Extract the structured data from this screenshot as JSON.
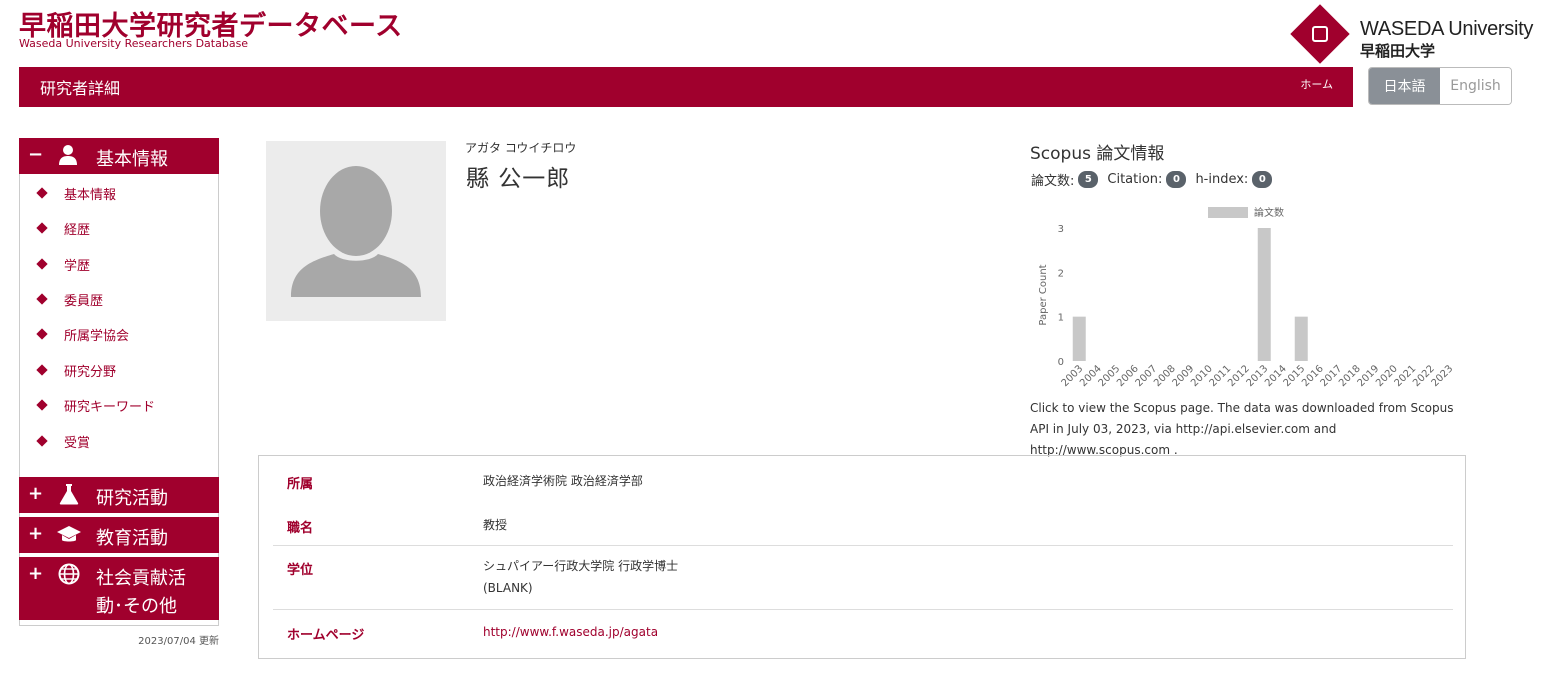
{
  "header": {
    "site_title": "早稲田大学研究者データベース",
    "site_subtitle": "Waseda University Researchers Database",
    "logo_en": "WASEDA University",
    "logo_jp": "早稲田大学"
  },
  "navbar": {
    "title": "研究者詳細",
    "home": "ホーム"
  },
  "lang": {
    "ja": "日本語",
    "en": "English"
  },
  "sidebar": {
    "sections": [
      {
        "sign": "−",
        "label": "基本情報",
        "icon": "person-icon"
      },
      {
        "sign": "+",
        "label": "研究活動",
        "icon": "flask-icon"
      },
      {
        "sign": "+",
        "label": "教育活動",
        "icon": "graduation-cap-icon"
      },
      {
        "sign": "+",
        "label": "社会貢献活動･その他",
        "label_line1": "社会貢献活",
        "label_line2": "動･その他",
        "icon": "globe-icon"
      }
    ],
    "items": [
      "基本情報",
      "経歴",
      "学歴",
      "委員歴",
      "所属学協会",
      "研究分野",
      "研究キーワード",
      "受賞"
    ],
    "updated": "2023/07/04 更新"
  },
  "profile": {
    "kana": "アガタ コウイチロウ",
    "name": "縣 公一郎"
  },
  "scopus": {
    "title": "Scopus 論文情報",
    "papers_label": "論文数:",
    "papers": "5",
    "citation_label": "Citation:",
    "citation": "0",
    "hindex_label": "h-index:",
    "hindex": "0",
    "note": "Click to view the Scopus page. The data was downloaded from Scopus API in July 03, 2023, via http://api.elsevier.com and http://www.scopus.com ."
  },
  "chart_data": {
    "type": "bar",
    "categories": [
      "2003",
      "2004",
      "2005",
      "2006",
      "2007",
      "2008",
      "2009",
      "2010",
      "2011",
      "2012",
      "2013",
      "2014",
      "2015",
      "2016",
      "2017",
      "2018",
      "2019",
      "2020",
      "2021",
      "2022",
      "2023"
    ],
    "series": [
      {
        "name": "論文数",
        "values": [
          1,
          0,
          0,
          0,
          0,
          0,
          0,
          0,
          0,
          0,
          3,
          0,
          1,
          0,
          0,
          0,
          0,
          0,
          0,
          0,
          0
        ]
      }
    ],
    "xlabel": "",
    "ylabel": "Paper Count",
    "ylim": [
      0,
      3
    ],
    "yticks": [
      "0",
      "1",
      "2",
      "3"
    ],
    "legend_position": "top",
    "grid": false,
    "bar_color": "#c8c8c8"
  },
  "info": {
    "rows": [
      {
        "label": "所属",
        "value": "政治経済学術院 政治経済学部"
      },
      {
        "label": "職名",
        "value": "教授"
      },
      {
        "label": "学位",
        "value_line1": "シュパイアー行政大学院 行政学博士",
        "value_line2": "(BLANK)"
      },
      {
        "label": "ホームページ",
        "value": "http://www.f.waseda.jp/agata"
      }
    ]
  }
}
